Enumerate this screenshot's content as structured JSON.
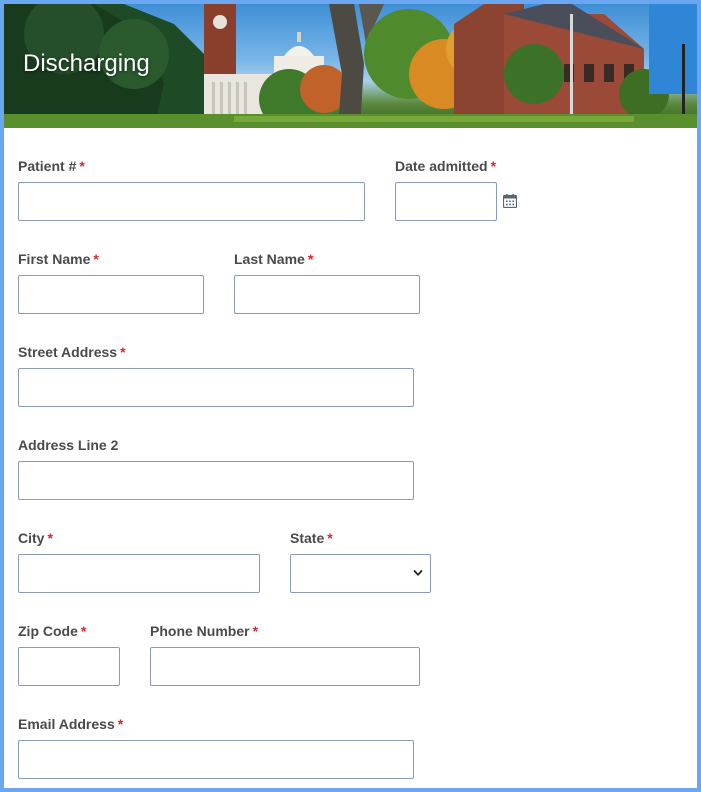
{
  "header": {
    "title": "Discharging"
  },
  "form": {
    "required_marker": "*",
    "patient_number": {
      "label": "Patient #",
      "value": ""
    },
    "date_admitted": {
      "label": "Date admitted",
      "value": "",
      "icon": "calendar-icon"
    },
    "first_name": {
      "label": "First Name",
      "value": ""
    },
    "last_name": {
      "label": "Last Name",
      "value": ""
    },
    "street_address": {
      "label": "Street Address",
      "value": ""
    },
    "address_line_2": {
      "label": "Address Line 2",
      "value": ""
    },
    "city": {
      "label": "City",
      "value": ""
    },
    "state": {
      "label": "State",
      "value": "",
      "icon": "chevron-down-icon"
    },
    "zip_code": {
      "label": "Zip Code",
      "value": ""
    },
    "phone_number": {
      "label": "Phone Number",
      "value": ""
    },
    "email_address": {
      "label": "Email Address",
      "value": ""
    }
  },
  "colors": {
    "frame_border": "#6aa7f0",
    "required": "#d9262c",
    "input_border": "#8a9bb8",
    "label_text": "#4a4a4a"
  }
}
